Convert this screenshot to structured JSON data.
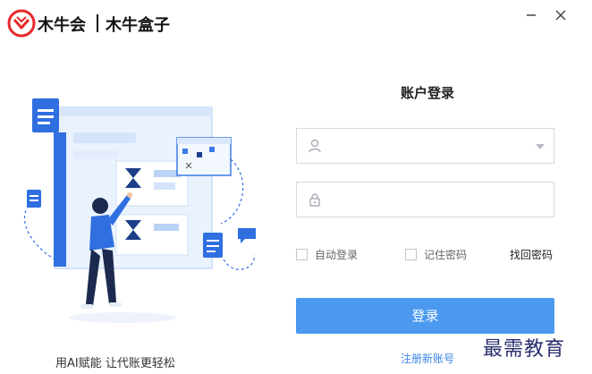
{
  "app": {
    "logo_text": "木牛会 | 木牛盒子",
    "brand_color": "#e8282b",
    "accent_color": "#4b9af0"
  },
  "window": {
    "minimize_icon": "minimize-icon",
    "close_icon": "close-icon"
  },
  "left": {
    "slogan": "用AI赋能 让代账更轻松",
    "illustration": "person-at-dashboard-illustration"
  },
  "login": {
    "title": "账户登录",
    "username": {
      "value": "",
      "placeholder": "",
      "icon": "user-icon"
    },
    "password": {
      "value": "",
      "placeholder": "",
      "icon": "lock-icon"
    },
    "auto_login_label": "自动登录",
    "auto_login_checked": false,
    "remember_password_label": "记住密码",
    "remember_password_checked": false,
    "recover_password": "找回密码",
    "submit_label": "登录",
    "register_label": "注册新账号"
  },
  "watermark": "最需教育"
}
